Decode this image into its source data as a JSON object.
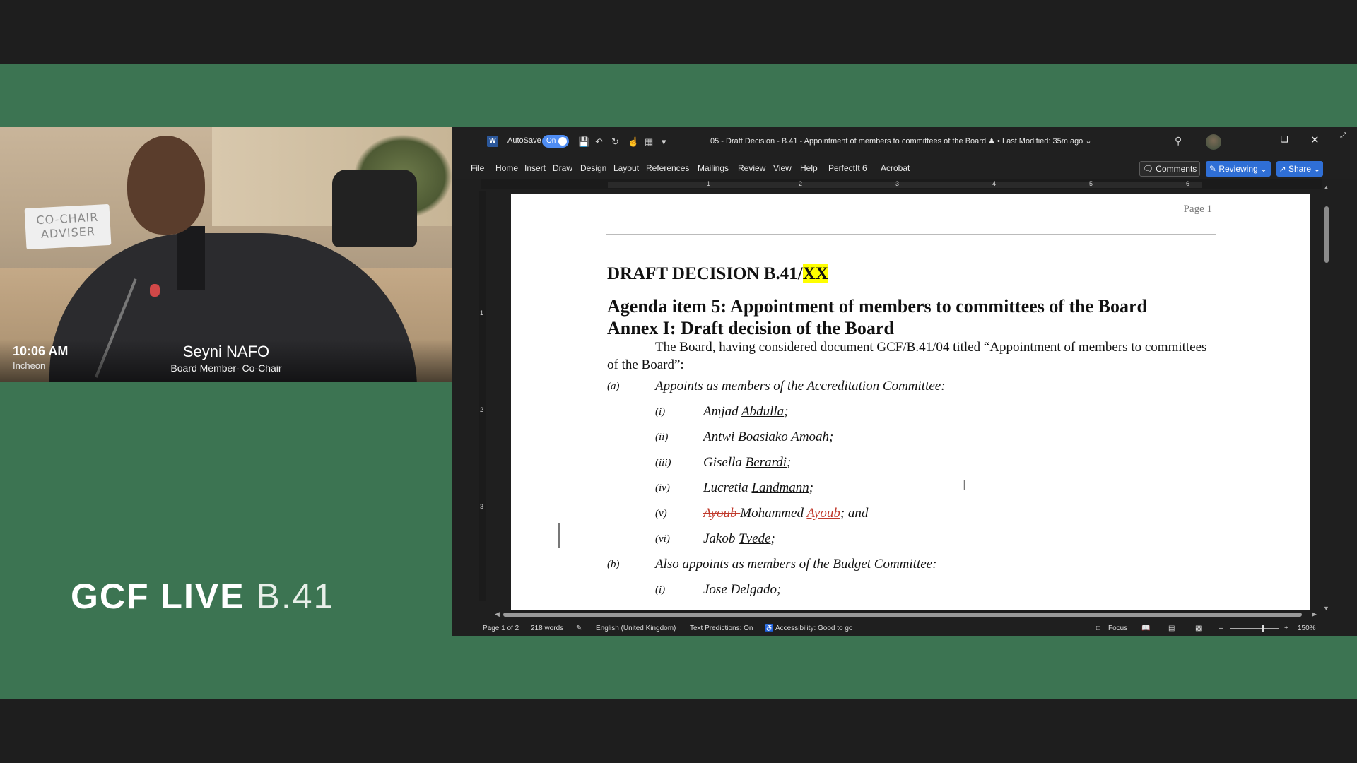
{
  "video": {
    "time": "10:06 AM",
    "location": "Incheon",
    "speaker_name": "Seyni NAFO",
    "speaker_role": "Board Member- Co-Chair",
    "sign_text": "CO-CHAIR ADVISER"
  },
  "branding": {
    "logo_bold": "GCF LIVE",
    "logo_light": "B.41"
  },
  "word": {
    "autosave_label": "AutoSave",
    "autosave_state": "On",
    "document_title": "05 - Draft Decision - B.41 - Appointment of members to committees of the Board",
    "last_modified": "• Last Modified: 35m ago",
    "menu": [
      "File",
      "Home",
      "Insert",
      "Draw",
      "Design",
      "Layout",
      "References",
      "Mailings",
      "Review",
      "View",
      "Help",
      "PerfectIt 6",
      "Acrobat"
    ],
    "comments_label": "Comments",
    "reviewing_label": "Reviewing",
    "share_label": "Share",
    "ruler_numbers": [
      "1",
      "2",
      "3",
      "4",
      "5",
      "6"
    ],
    "vruler_numbers": [
      "1",
      "2",
      "3"
    ],
    "status": {
      "page": "Page 1 of 2",
      "words": "218 words",
      "language": "English (United Kingdom)",
      "predictions": "Text Predictions: On",
      "accessibility": "Accessibility: Good to go",
      "focus": "Focus",
      "zoom": "150%"
    }
  },
  "document": {
    "header_page": "Page 1",
    "title_prefix": "DRAFT DECISION B.41/",
    "title_highlight": "XX",
    "agenda_line1": "Agenda item 5: Appointment of members to committees of the Board",
    "agenda_line2": "Annex I:  Draft decision of the Board",
    "intro": "The Board, having considered document GCF/B.41/04 titled “Appointment of members to committees of the Board”:",
    "item_a_mark": "(a)",
    "item_a_verb": "Appoints",
    "item_a_rest": " as members of the Accreditation Committee:",
    "members": [
      {
        "mark": "(i)",
        "first": "Amjad ",
        "last": "Abdulla",
        "end": ";"
      },
      {
        "mark": "(ii)",
        "first": "Antwi ",
        "last": "Boasiako Amoah",
        "end": ";"
      },
      {
        "mark": "(iii)",
        "first": "Gisella ",
        "last": "Berardi",
        "end": ";"
      },
      {
        "mark": "(iv)",
        "first": "Lucretia ",
        "last": "Landmann",
        "end": ";"
      },
      {
        "mark": "(vi)",
        "first": "Jakob ",
        "last": "Tvede",
        "end": ";"
      }
    ],
    "member_v": {
      "mark": "(v)",
      "deleted": "Ayoub ",
      "middle": "Mohammed ",
      "inserted": "Ayoub",
      "end": "; and"
    },
    "item_b_mark": "(b)",
    "item_b_verb": "Also appoints",
    "item_b_rest": " as members of the Budget Committee:",
    "item_b_first": "Jose Delgado;",
    "item_b_first_mark": "(i)"
  }
}
